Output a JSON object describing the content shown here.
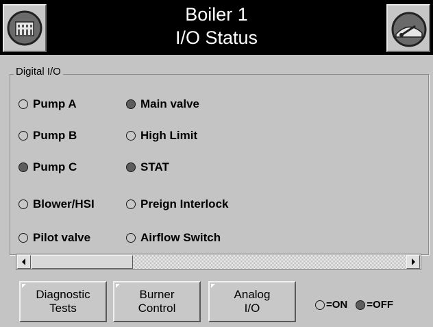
{
  "header": {
    "title_line1": "Boiler 1",
    "title_line2": "I/O Status",
    "left_button_icon": "building-icon",
    "right_button_icon": "gauge-icon"
  },
  "digital_io": {
    "group_label": "Digital I/O",
    "columns": [
      [
        {
          "label": "Pump A",
          "state": "on"
        },
        {
          "label": "Pump B",
          "state": "on"
        },
        {
          "label": "Pump C",
          "state": "off"
        },
        {
          "label": "Blower/HSI",
          "state": "on"
        },
        {
          "label": "Pilot valve",
          "state": "on"
        }
      ],
      [
        {
          "label": "Main valve",
          "state": "off"
        },
        {
          "label": "High Limit",
          "state": "on"
        },
        {
          "label": "STAT",
          "state": "off"
        },
        {
          "label": "Preign Interlock",
          "state": "on"
        },
        {
          "label": "Airflow Switch",
          "state": "on"
        }
      ]
    ]
  },
  "footer": {
    "buttons": [
      {
        "line1": "Diagnostic",
        "line2": "Tests"
      },
      {
        "line1": "Burner",
        "line2": "Control"
      },
      {
        "line1": "Analog",
        "line2": "I/O"
      }
    ],
    "legend_on": "=ON",
    "legend_off": "=OFF"
  },
  "colors": {
    "header_bg": "#000000",
    "panel_bg": "#c4c4c4",
    "led_on": "#c7c7c7",
    "led_off": "#5d5d5d"
  }
}
